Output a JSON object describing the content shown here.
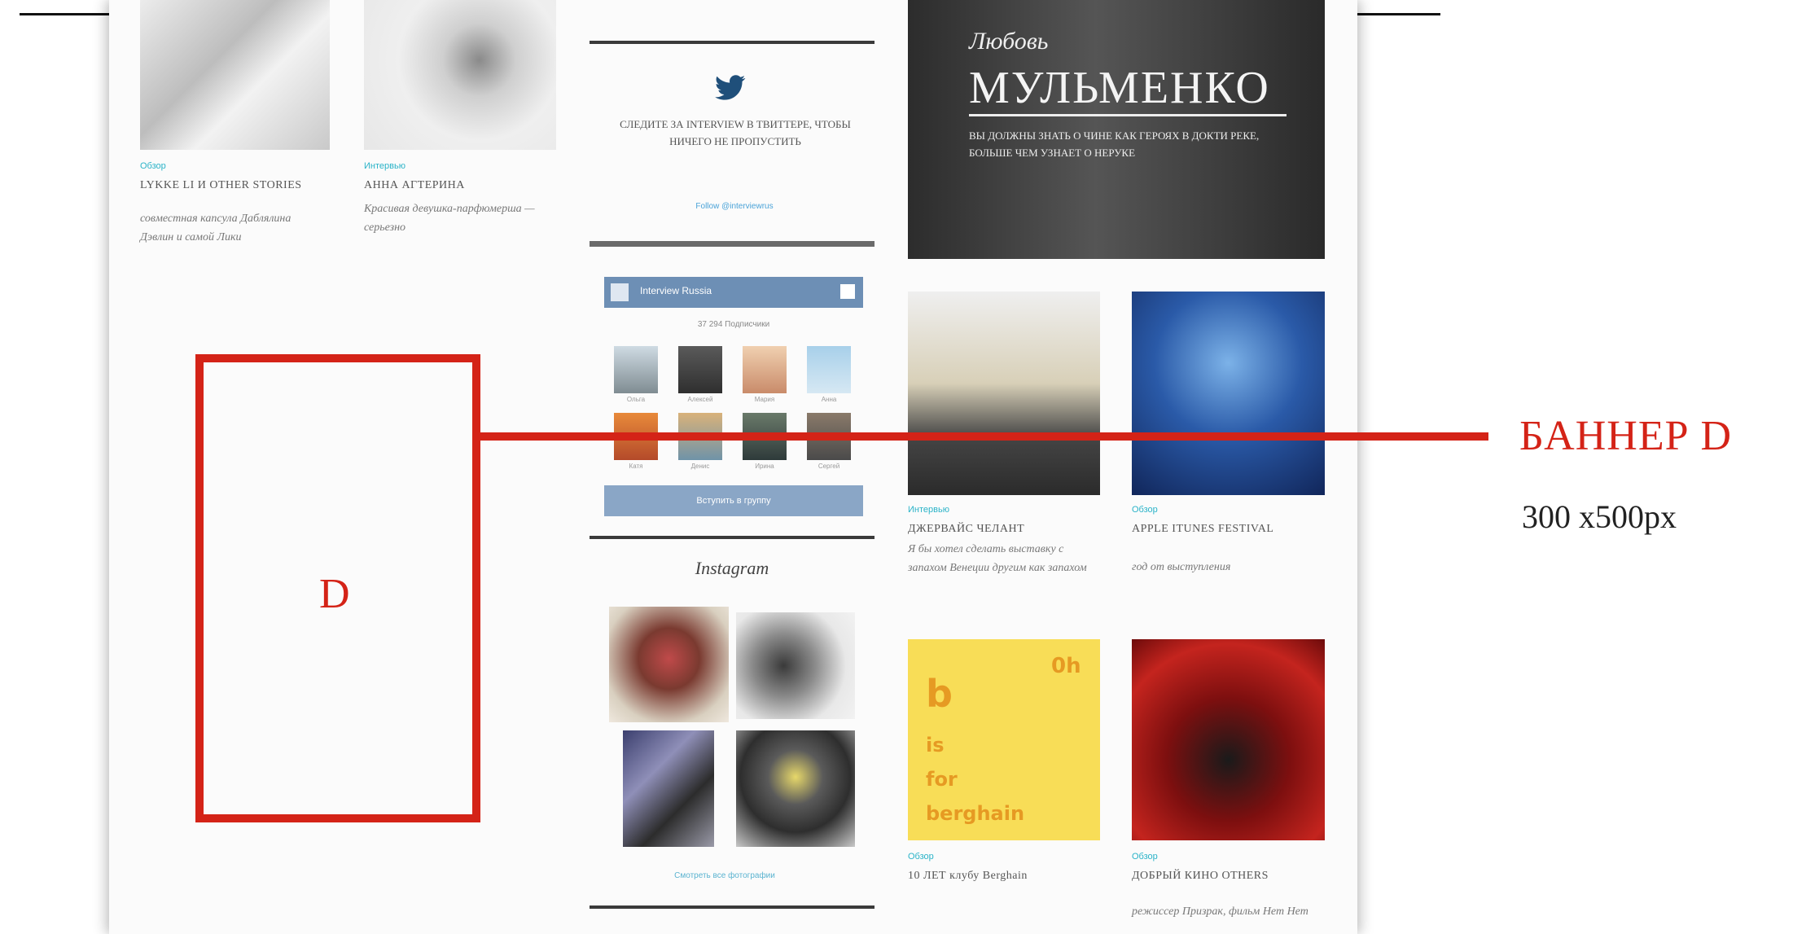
{
  "left_articles": [
    {
      "category": "Обзор",
      "title": "LYKKE LI И OTHER STORIES",
      "subtitle": "совместная капсула Даблялина Дэвлин и самой Лики"
    },
    {
      "category": "Интервью",
      "title": "АННА АГТЕРИНА",
      "subtitle": "Красивая девушка-парфюмерша — серьезно"
    }
  ],
  "twitter": {
    "text": "Следите за INTERVIEW В ТВИТТЕРЕ, ЧТОБЫ НИЧЕГО НЕ ПРОПУСТИТЬ",
    "follow": "Follow @interviewrus"
  },
  "vk": {
    "group_name": "Interview Russia",
    "count": "37 294 Подписчики",
    "members": [
      "Ольга",
      "Алексей",
      "Мария",
      "Анна",
      "Катя",
      "Денис",
      "Ирина",
      "Сергей"
    ],
    "join": "Вступить в группу"
  },
  "instagram": {
    "title": "Instagram",
    "link": "Смотреть все фотографии"
  },
  "hero": {
    "script": "Любовь",
    "title": "МУЛЬМЕНКО",
    "subtitle": "ВЫ ДОЛЖНЫ ЗНАТЬ О ЧИНЕ КАК ГЕРОЯХ В ДОКТИ РЕКЕ, БОЛЬШЕ ЧЕМ УЗНАЕТ О НЕРУКЕ"
  },
  "right_articles": [
    {
      "category": "Интервью",
      "title": "ДЖЕРВАЙС ЧЕЛАНТ",
      "subtitle": "Я бы хотел сделать выставку с запахом Венеции другим как запахом"
    },
    {
      "category": "Обзор",
      "title": "APPLE ITUNES FESTIVAL",
      "subtitle": "год от выступления"
    },
    {
      "category": "Обзор",
      "title": "10 ЛЕТ клубу Berghain",
      "subtitle": ""
    },
    {
      "category": "Обзор",
      "title": "ДОБРЫЙ КИНО OTHERS",
      "subtitle": "режиссер Призрак, фильм Нет Нет"
    }
  ],
  "berghain": {
    "corner": "0h",
    "b": "b",
    "is": "is",
    "for": "for",
    "name": "berghain"
  },
  "banner": {
    "letter": "D",
    "label": "БАННЕР D",
    "size": "300 x500px"
  },
  "colors": {
    "banner_red": "#d42317",
    "category_teal": "#2ab3c8",
    "vk_blue": "#6d8fb5",
    "berghain_yellow": "#f8dd57",
    "twitter_blue": "#1f4f7a"
  }
}
